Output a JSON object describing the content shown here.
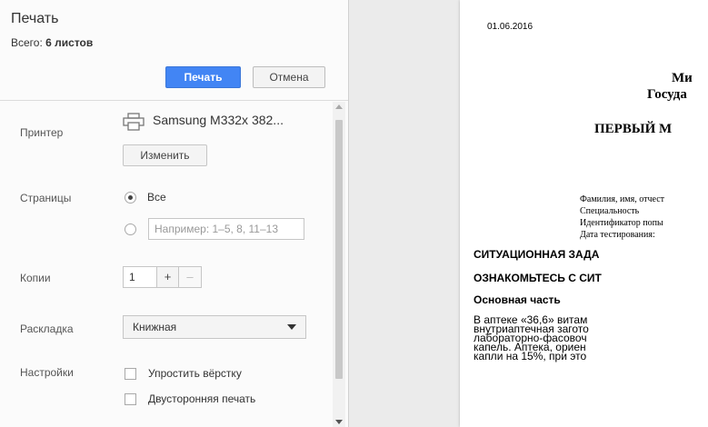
{
  "sidebar": {
    "title": "Печать",
    "total_prefix": "Всего:",
    "total_value": "6 листов",
    "print_button": "Печать",
    "cancel_button": "Отмена",
    "printer": {
      "label": "Принтер",
      "name": "Samsung M332x 382...",
      "change_button": "Изменить"
    },
    "pages": {
      "label": "Страницы",
      "all_option": "Все",
      "custom_placeholder": "Например: 1–5, 8, 11–13"
    },
    "copies": {
      "label": "Копии",
      "value": "1",
      "plus": "+",
      "minus": "–"
    },
    "layout": {
      "label": "Раскладка",
      "value": "Книжная"
    },
    "settings": {
      "label": "Настройки",
      "option_simplify": "Упростить вёрстку",
      "option_duplex": "Двусторонняя печать"
    }
  },
  "preview": {
    "date": "01.06.2016",
    "heading_line1": "Ми",
    "heading_line2": "Госуда",
    "heading_line3": "ПЕРВЫЙ М",
    "fields": [
      "Фамилия, имя, отчест",
      "Специальность",
      "Идентификатор попы",
      "Дата тестирования:"
    ],
    "section1": "СИТУАЦИОННАЯ ЗАДА",
    "section2": "ОЗНАКОМЬТЕСЬ С СИТ",
    "section3": "Основная часть",
    "body_lines": [
      "В аптеке «36,6» витам",
      "внутриаптечная загото",
      "лабораторно-фасовоч",
      "капель. Аптека, ориен",
      "капли на 15%, при это"
    ]
  }
}
